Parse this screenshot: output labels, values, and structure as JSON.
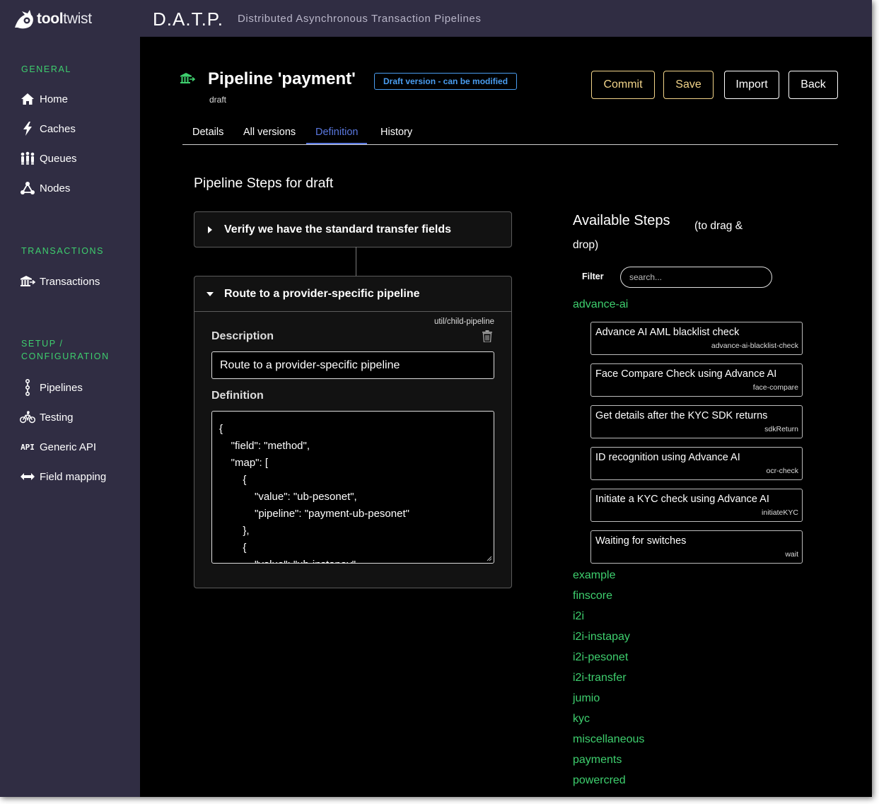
{
  "header": {
    "logo_bold": "tool",
    "logo_light": "twist",
    "app_title": "D.A.T.P.",
    "app_subtitle": "Distributed Asynchronous Transaction Pipelines"
  },
  "sidebar": {
    "general_label": "GENERAL",
    "transactions_label": "TRANSACTIONS",
    "setup_label_1": "SETUP /",
    "setup_label_2": "CONFIGURATION",
    "items": [
      {
        "label": "Home",
        "icon": "home-icon"
      },
      {
        "label": "Caches",
        "icon": "lightning-icon"
      },
      {
        "label": "Queues",
        "icon": "people-queue-icon"
      },
      {
        "label": "Nodes",
        "icon": "nodes-icon"
      },
      {
        "label": "Transactions",
        "icon": "bank-icon"
      },
      {
        "label": "Pipelines",
        "icon": "pipeline-icon"
      },
      {
        "label": "Testing",
        "icon": "bicycle-icon"
      },
      {
        "label": "Generic API",
        "icon": "api-icon"
      },
      {
        "label": "Field mapping",
        "icon": "arrows-left-right-icon"
      }
    ],
    "api_icon_text": "API"
  },
  "page": {
    "title": "Pipeline 'payment'",
    "subtitle": "draft",
    "badge": "Draft version - can be modified",
    "buttons": {
      "commit": "Commit",
      "save": "Save",
      "import": "Import",
      "back": "Back"
    },
    "tabs": [
      "Details",
      "All versions",
      "Definition",
      "History"
    ],
    "active_tab": "Definition"
  },
  "steps": {
    "heading": "Pipeline Steps for draft",
    "collapsed_step": "Verify we have the standard transfer fields",
    "expanded_step": {
      "title": "Route to a provider-specific pipeline",
      "type": "util/child-pipeline",
      "description_label": "Description",
      "description_value": "Route to a provider-specific pipeline",
      "definition_label": "Definition",
      "definition_text": "{\n    \"field\": \"method\",\n    \"map\": [\n        {\n            \"value\": \"ub-pesonet\",\n            \"pipeline\": \"payment-ub-pesonet\"\n        },\n        {\n            \"value\": \"ub-instapay\","
    }
  },
  "available": {
    "title": "Available Steps",
    "hint": "(to drag & drop)",
    "filter_label": "Filter",
    "filter_placeholder": "search...",
    "open_category": "advance-ai",
    "items": [
      {
        "title": "Advance AI AML blacklist check",
        "id": "advance-ai-blacklist-check"
      },
      {
        "title": "Face Compare Check using Advance AI",
        "id": "face-compare"
      },
      {
        "title": "Get details after the KYC SDK returns",
        "id": "sdkReturn"
      },
      {
        "title": "ID recognition using Advance AI",
        "id": "ocr-check"
      },
      {
        "title": "Initiate a KYC check using Advance AI",
        "id": "initiateKYC"
      },
      {
        "title": "Waiting for switches",
        "id": "wait"
      }
    ],
    "categories": [
      "example",
      "finscore",
      "i2i",
      "i2i-instapay",
      "i2i-pesonet",
      "i2i-transfer",
      "jumio",
      "kyc",
      "miscellaneous",
      "payments",
      "powercred"
    ]
  },
  "colors": {
    "sidebar_bg": "#302d43",
    "accent_green": "#3ecf6e",
    "accent_blue": "#4a9df0",
    "gold": "#f3d58a",
    "tab_active": "#5a78e0"
  }
}
